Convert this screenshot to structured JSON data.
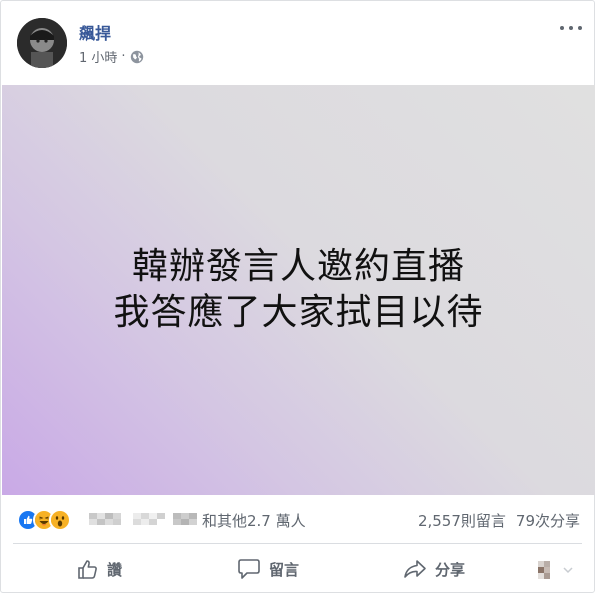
{
  "post": {
    "author": "飆捍",
    "time": "1 小時",
    "separator": "·",
    "image_text": {
      "line1": "韓辦發言人邀約直播",
      "line2": "我答應了大家拭目以待"
    }
  },
  "reactions": {
    "icons": [
      "like-icon",
      "haha-icon",
      "wow-icon"
    ],
    "others_text": "和其他2.7 萬人",
    "comments_count": "2,557則留言",
    "shares_count": "79次分享"
  },
  "actions": {
    "like_label": "讚",
    "comment_label": "留言",
    "share_label": "分享"
  },
  "colors": {
    "author_link": "#385898",
    "like_blue": "#1877f2",
    "reaction_yellow": "#f7b125",
    "secondary_text": "#606770"
  }
}
